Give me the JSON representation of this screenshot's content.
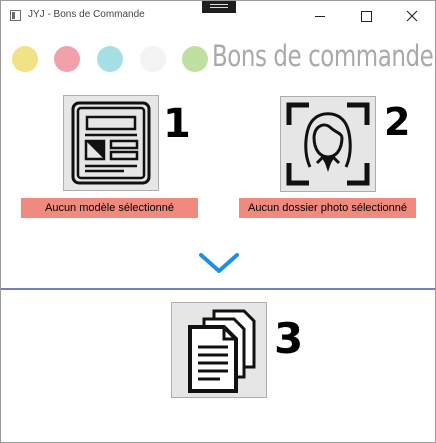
{
  "window": {
    "title": "JYJ - Bons de Commande"
  },
  "header": {
    "app_title": "Bons de commande",
    "color_dots": [
      "#f3e186",
      "#f2a1ab",
      "#a7dfe6",
      "#f3f3f3",
      "#bfe0a0"
    ]
  },
  "steps": [
    {
      "number": "1",
      "icon": "template-layout-icon",
      "status": "Aucun modèle sélectionné",
      "status_color": "#f08a7f"
    },
    {
      "number": "2",
      "icon": "face-scan-photo-icon",
      "status": "Aucun dossier photo sélectionné",
      "status_color": "#f08a7f"
    },
    {
      "number": "3",
      "icon": "documents-stack-icon"
    }
  ],
  "accent_color": "#1e90e0",
  "divider_color": "#6e7fc6"
}
